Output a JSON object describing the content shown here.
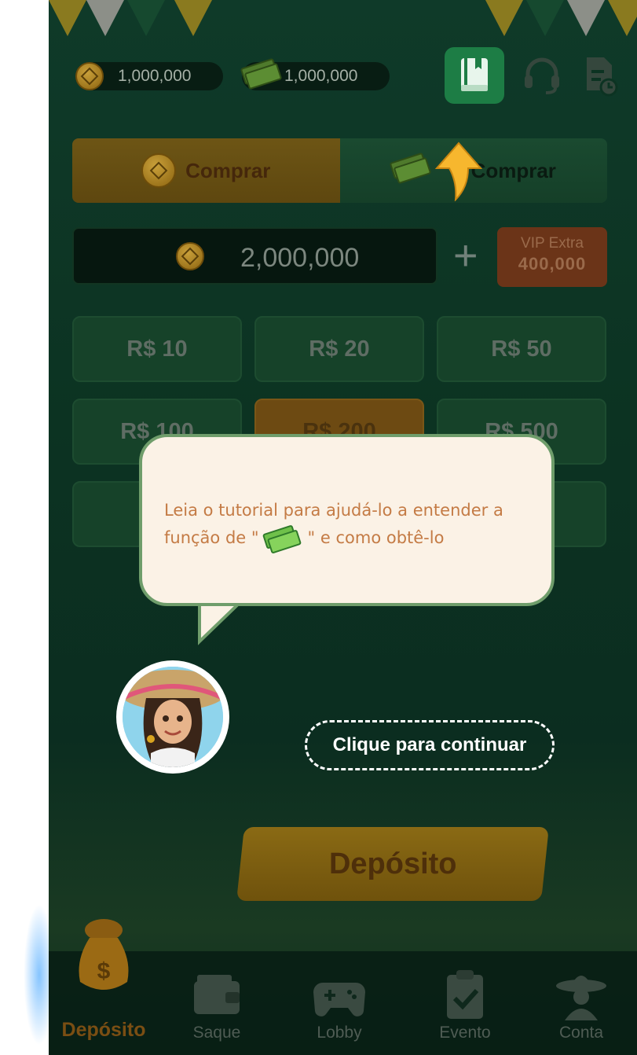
{
  "header": {
    "coin_balance": "1,000,000",
    "cash_balance": "1,000,000",
    "icons": [
      "book-icon",
      "headset-icon",
      "record-icon"
    ]
  },
  "buy_tabs": [
    {
      "label": "Comprar",
      "icon": "coin-icon"
    },
    {
      "label": "Comprar",
      "icon": "cash-icon"
    }
  ],
  "amount": {
    "value": "2,000,000",
    "vip_label": "VIP Extra",
    "vip_value": "400,000"
  },
  "options": [
    {
      "label": "R$ 10"
    },
    {
      "label": "R$ 20"
    },
    {
      "label": "R$ 50"
    },
    {
      "label": "R$ 100"
    },
    {
      "label": "R$ 200"
    },
    {
      "label": "R$ 500"
    }
  ],
  "tutorial": {
    "text_part1": "Leia o tutorial para ajudá-lo a entender a função de \"",
    "text_part2": "\" e como obtê-lo",
    "continue": "Clique para continuar"
  },
  "deposit_button": "Depósito",
  "nav": [
    {
      "label": "Depósito",
      "icon": "money-bag-icon",
      "active": true
    },
    {
      "label": "Saque",
      "icon": "wallet-icon"
    },
    {
      "label": "Lobby",
      "icon": "gamepad-icon"
    },
    {
      "label": "Evento",
      "icon": "clipboard-check-icon"
    },
    {
      "label": "Conta",
      "icon": "sombrero-user-icon"
    }
  ],
  "colors": {
    "background": "#0c3322",
    "bubble": "#fbf2e6",
    "bubble_border": "#6f9d6b",
    "bubble_text": "#c47b45",
    "pointer": "#f7b72e"
  }
}
